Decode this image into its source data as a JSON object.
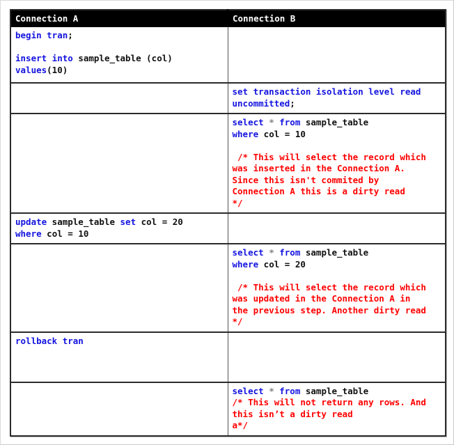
{
  "table": {
    "headers": {
      "col_a": "Connection A",
      "col_b": "Connection B"
    },
    "header_bg": "#000000",
    "header_fg": "#ffffff",
    "keyword_color": "#1414e0",
    "comment_color": "#ff0000",
    "plain_color": "#101010",
    "operator_color": "#808080",
    "rows": [
      {
        "id": "row-1",
        "a": {
          "lines": [
            [
              {
                "t": "begin tran",
                "c": "kw"
              },
              {
                "t": ";",
                "c": "pln"
              }
            ],
            [],
            [
              {
                "t": "insert into",
                "c": "kw"
              },
              {
                "t": " sample_table (col)",
                "c": "pln"
              }
            ],
            [
              {
                "t": "values",
                "c": "kw"
              },
              {
                "t": "(10)",
                "c": "pln"
              }
            ]
          ]
        },
        "b": {
          "lines": []
        }
      },
      {
        "id": "row-2",
        "a": {
          "lines": []
        },
        "b": {
          "lines": [
            [
              {
                "t": "set transaction isolation level read",
                "c": "kw"
              }
            ],
            [
              {
                "t": "uncommitted",
                "c": "kw"
              },
              {
                "t": ";",
                "c": "pln"
              }
            ]
          ]
        }
      },
      {
        "id": "row-3",
        "a": {
          "lines": []
        },
        "b": {
          "lines": [
            [
              {
                "t": "select ",
                "c": "kw"
              },
              {
                "t": "*",
                "c": "ast"
              },
              {
                "t": " from",
                "c": "kw"
              },
              {
                "t": " sample_table",
                "c": "pln"
              }
            ],
            [
              {
                "t": "where",
                "c": "kw"
              },
              {
                "t": " col = 10",
                "c": "pln"
              }
            ],
            [],
            [
              {
                "t": " /* This will select the record which",
                "c": "cmt"
              }
            ],
            [
              {
                "t": "was inserted in the Connection A.",
                "c": "cmt"
              }
            ],
            [
              {
                "t": "Since this isn't commited by",
                "c": "cmt"
              }
            ],
            [
              {
                "t": "Connection A this is a dirty read",
                "c": "cmt"
              }
            ],
            [
              {
                "t": "*/",
                "c": "cmt"
              }
            ]
          ]
        }
      },
      {
        "id": "row-4",
        "a": {
          "lines": [
            [
              {
                "t": "update",
                "c": "kw"
              },
              {
                "t": " sample_table ",
                "c": "pln"
              },
              {
                "t": "set",
                "c": "kw"
              },
              {
                "t": " col = 20",
                "c": "pln"
              }
            ],
            [
              {
                "t": "where",
                "c": "kw"
              },
              {
                "t": " col = 10",
                "c": "pln"
              }
            ]
          ]
        },
        "b": {
          "lines": []
        }
      },
      {
        "id": "row-5",
        "a": {
          "lines": []
        },
        "b": {
          "lines": [
            [
              {
                "t": "select ",
                "c": "kw"
              },
              {
                "t": "*",
                "c": "ast"
              },
              {
                "t": " from",
                "c": "kw"
              },
              {
                "t": " sample_table",
                "c": "pln"
              }
            ],
            [
              {
                "t": "where",
                "c": "kw"
              },
              {
                "t": " col = 20",
                "c": "pln"
              }
            ],
            [],
            [
              {
                "t": " /* This will select the record which",
                "c": "cmt"
              }
            ],
            [
              {
                "t": "was updated in the Connection A in",
                "c": "cmt"
              }
            ],
            [
              {
                "t": "the previous step. Another dirty read",
                "c": "cmt"
              }
            ],
            [
              {
                "t": "*/",
                "c": "cmt"
              }
            ]
          ]
        }
      },
      {
        "id": "row-6",
        "a": {
          "lines": [
            [
              {
                "t": "rollback tran",
                "c": "kw"
              }
            ]
          ]
        },
        "b": {
          "lines": []
        }
      },
      {
        "id": "row-7",
        "a": {
          "lines": []
        },
        "b": {
          "lines": [
            [
              {
                "t": "select ",
                "c": "kw"
              },
              {
                "t": "*",
                "c": "ast"
              },
              {
                "t": " from",
                "c": "kw"
              },
              {
                "t": " sample_table",
                "c": "pln"
              }
            ],
            [
              {
                "t": "/* This will not return any rows. And",
                "c": "cmt"
              }
            ],
            [
              {
                "t": "this isn’t a dirty read",
                "c": "cmt"
              }
            ],
            [
              {
                "t": "a*/",
                "c": "cmt"
              }
            ]
          ]
        }
      }
    ],
    "row_heights": {
      "row-1": 80,
      "row-2": 44,
      "row-3": 141,
      "row-4": 38,
      "row-5": 124,
      "row-6": 72,
      "row-7": 76
    }
  }
}
